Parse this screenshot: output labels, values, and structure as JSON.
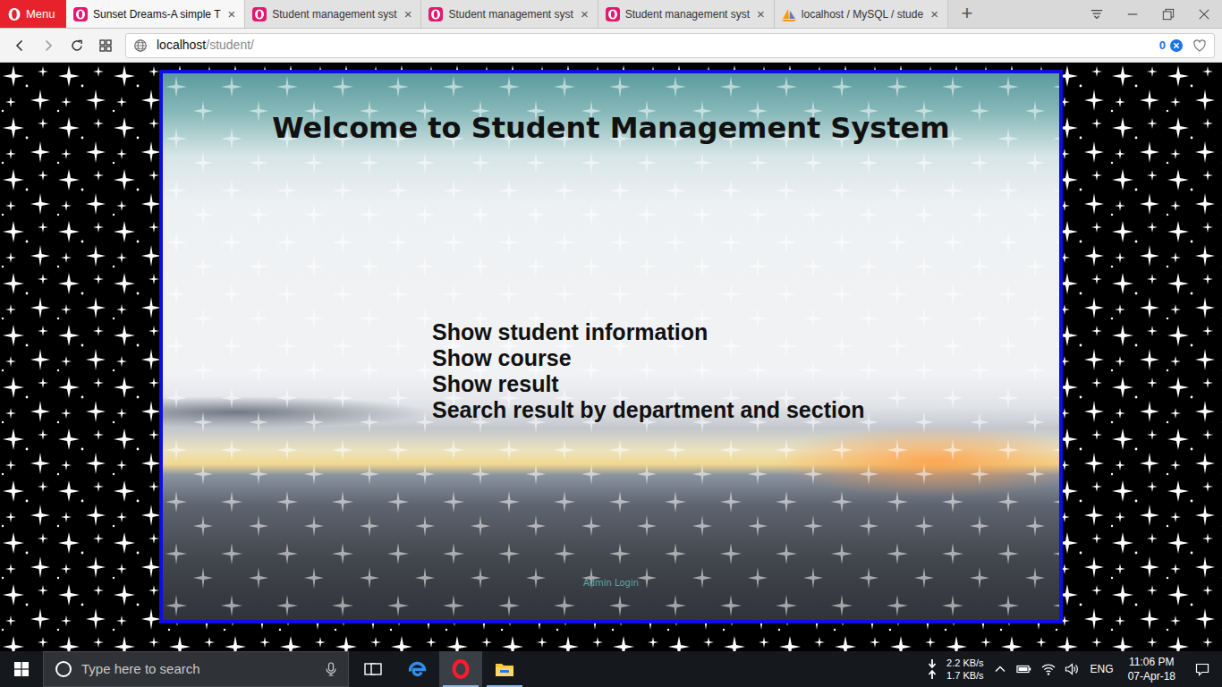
{
  "browser": {
    "menu_label": "Menu",
    "tabs": [
      {
        "label": "Sunset Dreams-A simple T",
        "selected": true,
        "kind": "opera",
        "close": "×"
      },
      {
        "label": "Student management syst",
        "selected": false,
        "kind": "opera",
        "close": "×"
      },
      {
        "label": "Student management syst",
        "selected": false,
        "kind": "opera",
        "close": "×"
      },
      {
        "label": "Student management syst",
        "selected": false,
        "kind": "opera",
        "close": "×"
      },
      {
        "label": "localhost / MySQL / stude",
        "selected": false,
        "kind": "phpmyadmin",
        "close": "×"
      }
    ],
    "new_tab": "+",
    "address": {
      "host": "localhost",
      "path": "/student/"
    },
    "badge_count": "0"
  },
  "page": {
    "title": "Welcome to Student Management System",
    "links": [
      {
        "label": "Show student information"
      },
      {
        "label": "Show course"
      },
      {
        "label": "Show result"
      },
      {
        "label": "Search result by department and section"
      }
    ],
    "admin_link": "Admin Login"
  },
  "taskbar": {
    "search_placeholder": "Type here to search",
    "apps": [
      {
        "kind": "task-view",
        "selected": false,
        "running": false
      },
      {
        "kind": "edge",
        "selected": false,
        "running": false
      },
      {
        "kind": "opera",
        "selected": true,
        "running": true
      },
      {
        "kind": "explorer",
        "selected": false,
        "running": true
      }
    ],
    "download_speed": "2.2 KB/s",
    "upload_speed": "1.7 KB/s",
    "language": "ENG",
    "time": "11:06 PM",
    "date": "07-Apr-18"
  }
}
